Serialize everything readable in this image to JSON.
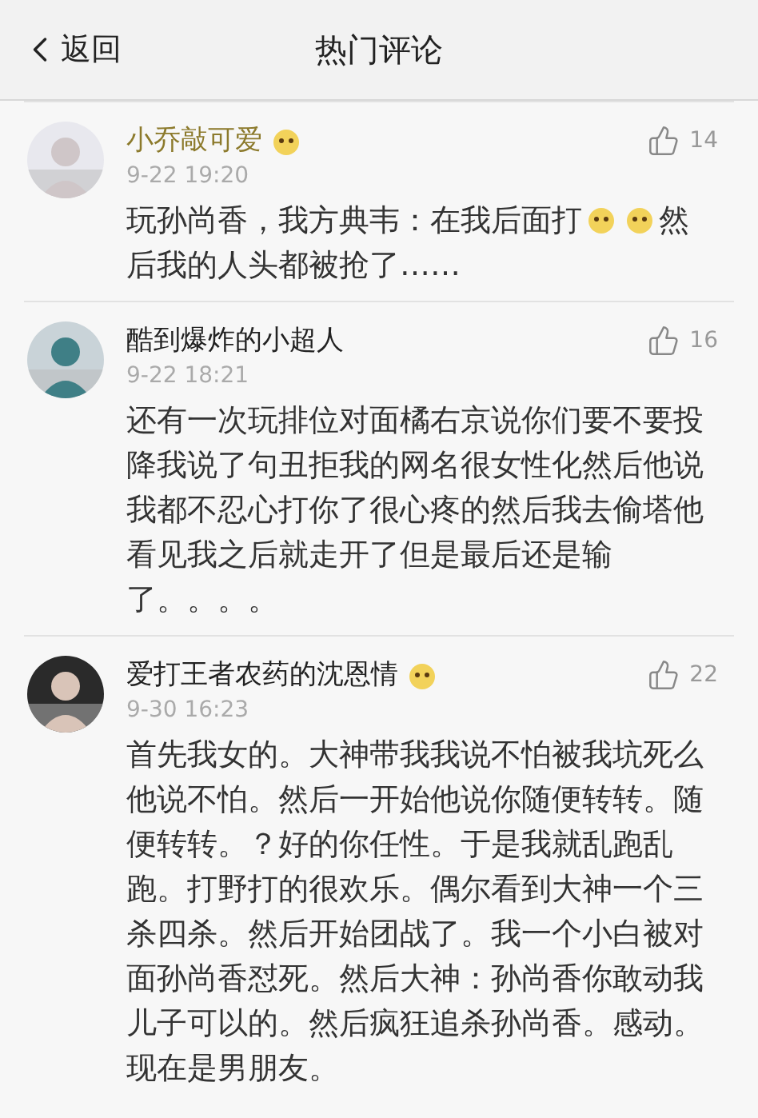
{
  "header": {
    "back": "返回",
    "title": "热门评论"
  },
  "comments": [
    {
      "name": "小乔敲可爱",
      "color": "#8c7a2c",
      "badge": true,
      "time": "9-22 19:20",
      "likes": "14",
      "body": [
        {
          "kind": "text",
          "text": "玩孙尚香，我方典韦：在我后面打"
        },
        {
          "kind": "emoji"
        },
        {
          "kind": "emoji"
        },
        {
          "kind": "text",
          "text": "然"
        },
        {
          "kind": "text",
          "text": "后我的人头都被抢了……"
        }
      ]
    },
    {
      "name": "酷到爆炸的小超人",
      "color": "#222222",
      "badge": false,
      "time": "9-22 18:21",
      "likes": "16",
      "body": [
        {
          "kind": "text",
          "text": "还有一次玩排位对面橘右京说你们要不要投降我说了句丑拒我的网名很女性化然后他说我都不忍心打你了很心疼的然后我去偷塔他看见我之后就走开了但是最后还是输了。。。。"
        }
      ]
    },
    {
      "name": "爱打王者农药的沈恩情",
      "color": "#222222",
      "badge": true,
      "time": "9-30 16:23",
      "likes": "22",
      "body": [
        {
          "kind": "text",
          "text": "首先我女的。大神带我我说不怕被我坑死么他说不怕。然后一开始他说你随便转转。随便转转。？好的你任性。于是我就乱跑乱跑。打野打的很欢乐。偶尔看到大神一个三杀四杀。然后开始团战了。我一个小白被对面孙尚香怼死。然后大神：孙尚香你敢动我儿子可以的。然后疯狂追杀孙尚香。感动。现在是男朋友。"
        }
      ]
    }
  ]
}
